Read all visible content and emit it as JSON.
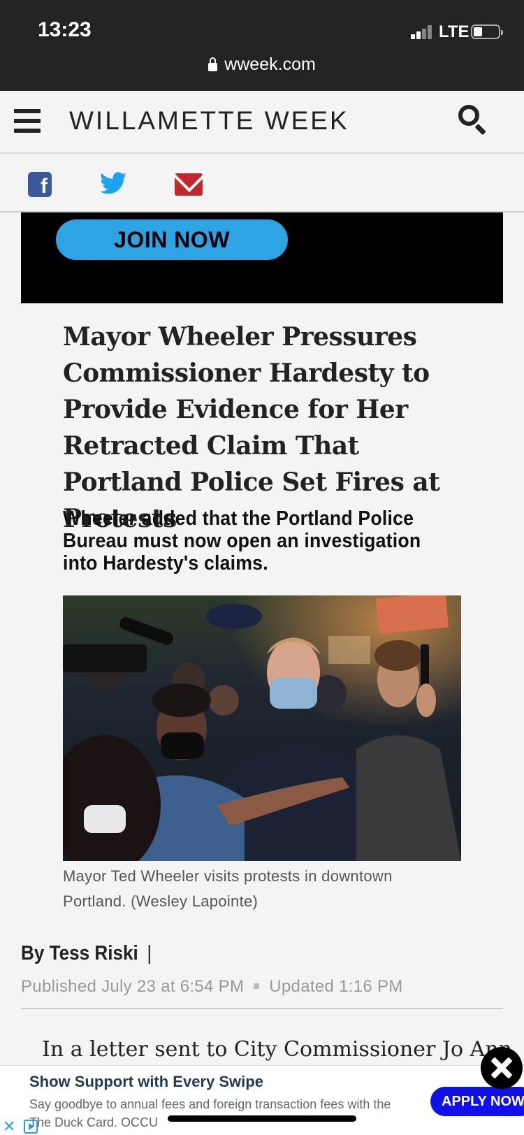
{
  "status_bar": {
    "time": "13:23",
    "network": "LTE",
    "url": "wweek.com"
  },
  "header": {
    "site_name": "WILLAMETTE WEEK",
    "icons": [
      "menu-icon",
      "search-icon"
    ]
  },
  "share": {
    "icons": [
      "facebook-icon",
      "twitter-icon",
      "email-icon"
    ],
    "facebook_glyph": "f"
  },
  "ad_banner": {
    "button_label": "JOIN NOW"
  },
  "article": {
    "headline": "Mayor Wheeler Pressures Commissioner Hardesty to Provide Evidence for Her Retracted Claim That Portland Police Set Fires at Protests",
    "subheadline": "Wheeler added that the Portland Police Bureau must now open an investigation into Hardesty's claims.",
    "photo_caption": "Mayor Ted Wheeler visits protests in downtown Portland. (Wesley Lapointe)",
    "byline": "By Tess Riski",
    "byline_separator": "|",
    "published": "Published July 23 at 6:54 PM",
    "updated": "Updated 1:16 PM",
    "body_start": "In a letter sent to City Commissioner Jo Ann"
  },
  "bottom_ad": {
    "title": "Show Support with Every Swipe",
    "body": "Say goodbye to annual fees and foreign transaction fees with the The Duck Card. OCCU",
    "button_label": "APPLY NOW"
  },
  "colors": {
    "status_bg": "#232323",
    "page_bg": "#f4f4f4",
    "facebook": "#3b5998",
    "twitter": "#1da1f2",
    "email": "#c0282e",
    "join_button": "#2ea3e3",
    "apply_button": "#1010e8"
  }
}
